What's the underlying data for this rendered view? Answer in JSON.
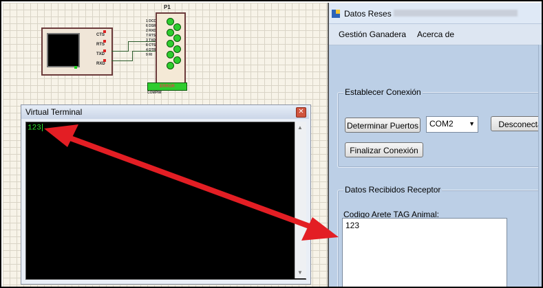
{
  "schematic": {
    "vterm_pins": [
      "CTS",
      "RTS",
      "TXD",
      "RXD"
    ],
    "connector_label": "P1",
    "db9_pin_numbers": [
      "1",
      "6",
      "2",
      "7",
      "3",
      "8",
      "4",
      "9"
    ],
    "db9_pin_names": [
      "DCD",
      "DSR",
      "RXD",
      "RTS",
      "TXD",
      "CTS",
      "DTR",
      "RI"
    ],
    "error_label": "ERROR",
    "component_label": "COMPIM"
  },
  "virtual_terminal": {
    "title": "Virtual Terminal",
    "screen_text": "123",
    "close_icon": "close-icon"
  },
  "app": {
    "title": "Datos Reses",
    "menu": [
      "Gestión Ganadera",
      "Acerca de"
    ],
    "connection_group": {
      "label": "Establecer Conexión",
      "determine_ports_label": "Determinar Puertos",
      "port_value": "COM2",
      "disconnect_label": "Desconectar",
      "finish_label": "Finalizar Conexión"
    },
    "received_group": {
      "label": "Datos Recibidos Receptor",
      "field_label": "Codigo Arete TAG Animal:",
      "field_value": "123"
    }
  },
  "colors": {
    "annotation_arrow": "#e31e24",
    "terminal_text": "#2ee02e",
    "app_background": "#bccfe6"
  }
}
